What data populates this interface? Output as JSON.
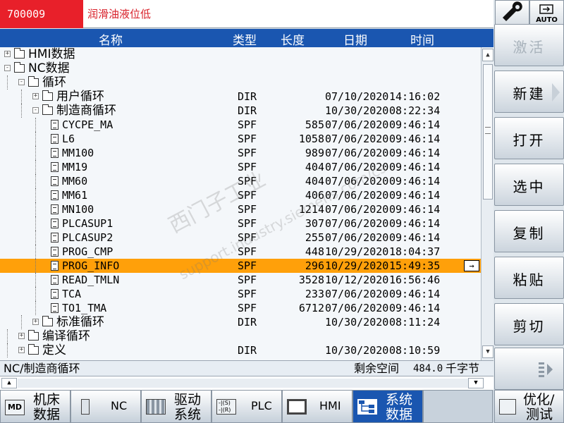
{
  "alarm": {
    "code": "700009",
    "text": "润滑油液位低"
  },
  "top_right": {
    "auto_label": "AUTO"
  },
  "columns": {
    "name": "名称",
    "type": "类型",
    "length": "长度",
    "date": "日期",
    "time": "时间"
  },
  "tree": [
    {
      "name": "HMI数据",
      "level": 0,
      "kind": "folder",
      "expander": "+",
      "type": "",
      "length": "",
      "date": "",
      "time": ""
    },
    {
      "name": "NC数据",
      "level": 0,
      "kind": "folder-open",
      "expander": "−",
      "type": "",
      "length": "",
      "date": "",
      "time": ""
    },
    {
      "name": "循环",
      "level": 1,
      "kind": "folder-open",
      "expander": "−",
      "type": "",
      "length": "",
      "date": "",
      "time": ""
    },
    {
      "name": "用户循环",
      "level": 2,
      "kind": "folder",
      "expander": "+",
      "type": "DIR",
      "length": "",
      "date": "07/10/2020",
      "time": "14:16:02"
    },
    {
      "name": "制造商循环",
      "level": 2,
      "kind": "folder-open",
      "expander": "−",
      "type": "DIR",
      "length": "",
      "date": "10/30/2020",
      "time": "08:22:34"
    },
    {
      "name": "CYCPE_MA",
      "level": 3,
      "kind": "file",
      "expander": "",
      "type": "SPF",
      "length": "585",
      "date": "07/06/2020",
      "time": "09:46:14"
    },
    {
      "name": "L6",
      "level": 3,
      "kind": "file",
      "expander": "",
      "type": "SPF",
      "length": "1058",
      "date": "07/06/2020",
      "time": "09:46:14"
    },
    {
      "name": "MM100",
      "level": 3,
      "kind": "file",
      "expander": "",
      "type": "SPF",
      "length": "989",
      "date": "07/06/2020",
      "time": "09:46:14"
    },
    {
      "name": "MM19",
      "level": 3,
      "kind": "file",
      "expander": "",
      "type": "SPF",
      "length": "404",
      "date": "07/06/2020",
      "time": "09:46:14"
    },
    {
      "name": "MM60",
      "level": 3,
      "kind": "file",
      "expander": "",
      "type": "SPF",
      "length": "404",
      "date": "07/06/2020",
      "time": "09:46:14"
    },
    {
      "name": "MM61",
      "level": 3,
      "kind": "file",
      "expander": "",
      "type": "SPF",
      "length": "406",
      "date": "07/06/2020",
      "time": "09:46:14"
    },
    {
      "name": "MN100",
      "level": 3,
      "kind": "file",
      "expander": "",
      "type": "SPF",
      "length": "1214",
      "date": "07/06/2020",
      "time": "09:46:14"
    },
    {
      "name": "PLCASUP1",
      "level": 3,
      "kind": "file",
      "expander": "",
      "type": "SPF",
      "length": "307",
      "date": "07/06/2020",
      "time": "09:46:14"
    },
    {
      "name": "PLCASUP2",
      "level": 3,
      "kind": "file",
      "expander": "",
      "type": "SPF",
      "length": "255",
      "date": "07/06/2020",
      "time": "09:46:14"
    },
    {
      "name": "PROG_CMP",
      "level": 3,
      "kind": "file",
      "expander": "",
      "type": "SPF",
      "length": "448",
      "date": "10/29/2020",
      "time": "18:04:37"
    },
    {
      "name": "PROG_INFO",
      "level": 3,
      "kind": "file",
      "expander": "",
      "type": "SPF",
      "length": "296",
      "date": "10/29/2020",
      "time": "15:49:35",
      "selected": true
    },
    {
      "name": "READ_TMLN",
      "level": 3,
      "kind": "file",
      "expander": "",
      "type": "SPF",
      "length": "3528",
      "date": "10/12/2020",
      "time": "16:56:46"
    },
    {
      "name": "TCA",
      "level": 3,
      "kind": "file",
      "expander": "",
      "type": "SPF",
      "length": "233",
      "date": "07/06/2020",
      "time": "09:46:14"
    },
    {
      "name": "TO1_TMA",
      "level": 3,
      "kind": "file",
      "expander": "",
      "type": "SPF",
      "length": "6712",
      "date": "07/06/2020",
      "time": "09:46:14"
    },
    {
      "name": "标准循环",
      "level": 2,
      "kind": "folder",
      "expander": "+",
      "type": "DIR",
      "length": "",
      "date": "10/30/2020",
      "time": "08:11:24"
    },
    {
      "name": "编译循环",
      "level": 1,
      "kind": "folder",
      "expander": "+",
      "type": "",
      "length": "",
      "date": "",
      "time": ""
    },
    {
      "name": "定义",
      "level": 1,
      "kind": "folder-open",
      "expander": "+",
      "type": "DIR",
      "length": "",
      "date": "10/30/2020",
      "time": "08:10:59"
    }
  ],
  "status": {
    "path": "NC/制造商循环",
    "free_label": "剩余空间",
    "free_value": "484.0",
    "free_unit": "千字节"
  },
  "softkeys": [
    {
      "label": "激活",
      "enabled": false,
      "arrow": false
    },
    {
      "label": "新建",
      "enabled": true,
      "arrow": true
    },
    {
      "label": "打开",
      "enabled": true,
      "arrow": false
    },
    {
      "label": "选中",
      "enabled": true,
      "arrow": false
    },
    {
      "label": "复制",
      "enabled": true,
      "arrow": false
    },
    {
      "label": "粘贴",
      "enabled": true,
      "arrow": false
    },
    {
      "label": "剪切",
      "enabled": true,
      "arrow": false
    }
  ],
  "bottom": {
    "machine_1": "机床",
    "machine_2": "数据",
    "nc": "NC",
    "drive_1": "驱动",
    "drive_2": "系统",
    "plc": "PLC",
    "hmi": "HMI",
    "sysdata_1": "系统",
    "sysdata_2": "数据",
    "optimize_1": "优化/",
    "optimize_2": "测试",
    "md_icon_text": "MD",
    "plc_icon_top": "-|(S)",
    "plc_icon_bottom": "-|(R)"
  },
  "watermark": {
    "line1": "西门子工业",
    "line2": "support.industry.siemens.com/cs"
  }
}
